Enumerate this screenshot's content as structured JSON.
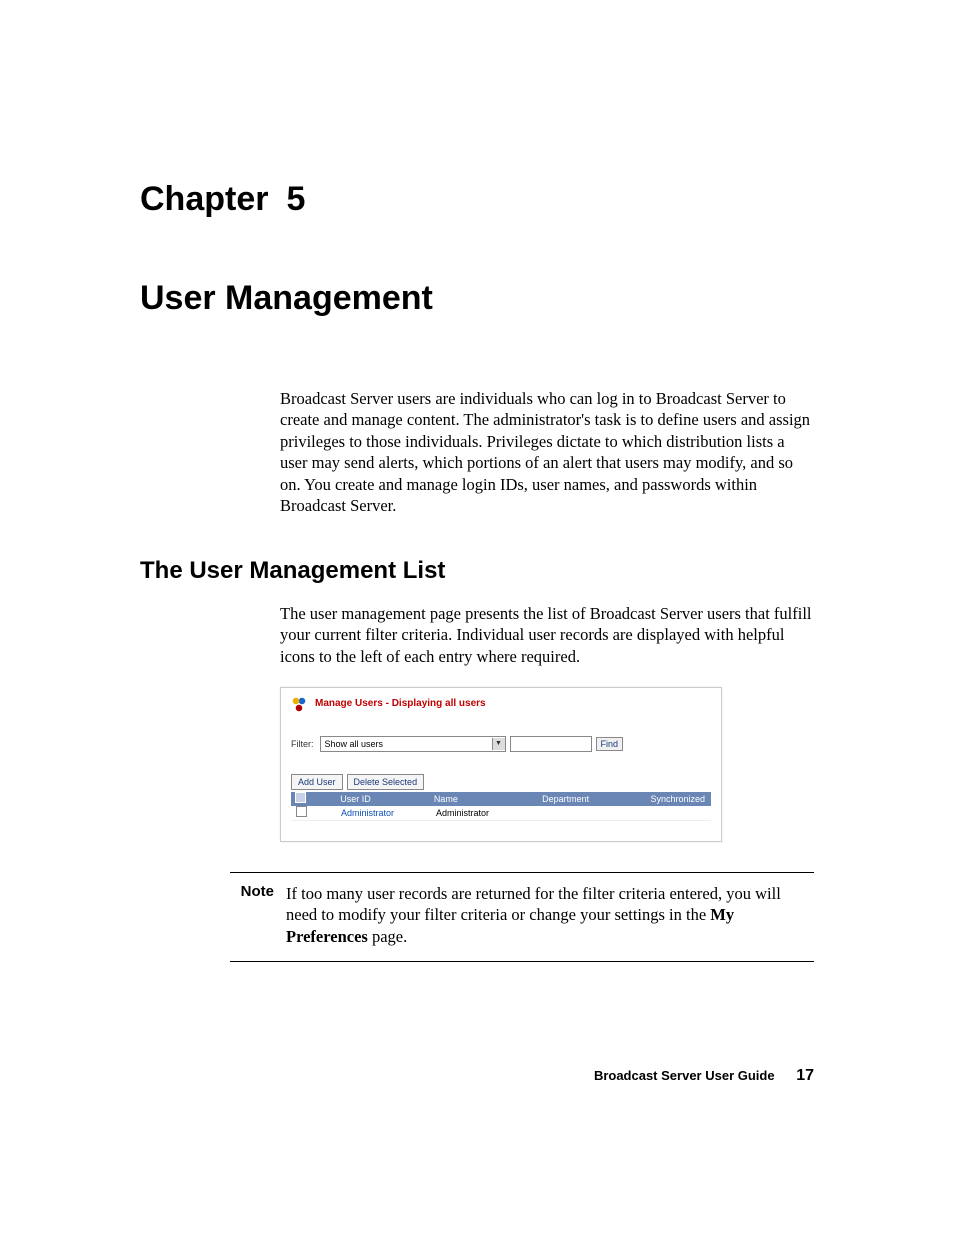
{
  "chapter": {
    "label": "Chapter",
    "number": "5",
    "title": "User Management"
  },
  "intro": "Broadcast Server users are individuals who can log in to Broadcast Server to create and manage content. The administrator's task is to define users and assign privileges to those individuals. Privileges dictate to which distribution lists a user may send alerts, which portions of an alert that users may modify, and so on. You create and manage login IDs, user names, and passwords within Broadcast Server.",
  "section": {
    "heading": "The User Management List",
    "para": "The user management page presents the list of Broadcast Server users that fulfill your current filter criteria. Individual user records are displayed with helpful icons to the left of each entry where required."
  },
  "figure": {
    "title": "Manage Users - Displaying all users",
    "filter_label": "Filter:",
    "filter_value": "Show all users",
    "find_label": "Find",
    "buttons": {
      "add": "Add User",
      "delete": "Delete Selected"
    },
    "columns": {
      "userid": "User ID",
      "name": "Name",
      "department": "Department",
      "sync": "Synchronized"
    },
    "rows": [
      {
        "userid": "Administrator",
        "name": "Administrator",
        "department": "",
        "sync": ""
      }
    ]
  },
  "note": {
    "label": "Note",
    "text_before": "If too many user records are returned for the filter criteria entered, you will need to modify your filter criteria or change your settings in the ",
    "bold": "My Preferences",
    "text_after": " page."
  },
  "footer": {
    "guide": "Broadcast Server User Guide",
    "page": "17"
  }
}
